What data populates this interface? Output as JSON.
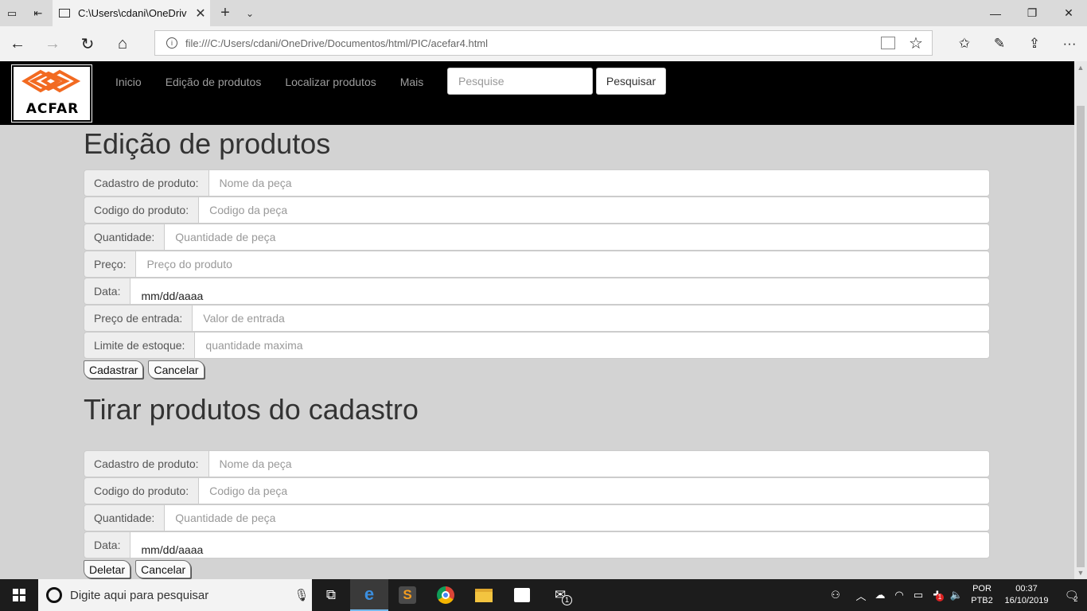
{
  "browser": {
    "tab_title": "C:\\Users\\cdani\\OneDriv",
    "url": "file:///C:/Users/cdani/OneDrive/Documentos/html/PIC/acefar4.html"
  },
  "site": {
    "logo_text": "ACFAR",
    "nav": [
      "Inicio",
      "Edição de produtos",
      "Localizar produtos",
      "Mais"
    ],
    "search_placeholder": "Pesquise",
    "search_button": "Pesquisar"
  },
  "edit_section": {
    "title": "Edição de produtos",
    "fields": [
      {
        "label": "Cadastro de produto:",
        "placeholder": "Nome da peça"
      },
      {
        "label": "Codigo do produto:",
        "placeholder": "Codigo da peça"
      },
      {
        "label": "Quantidade:",
        "placeholder": "Quantidade de peça"
      },
      {
        "label": "Preço:",
        "placeholder": "Preço do produto"
      },
      {
        "label": "Data:",
        "value": "mm/dd/aaaa"
      },
      {
        "label": "Preço de entrada:",
        "placeholder": "Valor de entrada"
      },
      {
        "label": "Limite de estoque:",
        "placeholder": "quantidade maxima"
      }
    ],
    "buttons": [
      "Cadastrar",
      "Cancelar"
    ]
  },
  "remove_section": {
    "title": "Tirar produtos do cadastro",
    "fields": [
      {
        "label": "Cadastro de produto:",
        "placeholder": "Nome da peça"
      },
      {
        "label": "Codigo do produto:",
        "placeholder": "Codigo da peça"
      },
      {
        "label": "Quantidade:",
        "placeholder": "Quantidade de peça"
      },
      {
        "label": "Data:",
        "value": "mm/dd/aaaa"
      }
    ],
    "buttons": [
      "Deletar",
      "Cancelar"
    ]
  },
  "taskbar": {
    "search_text": "Digite aqui para pesquisar",
    "lang_1": "POR",
    "lang_2": "PTB2",
    "time": "00:37",
    "date": "16/10/2019",
    "notifications": "2",
    "mail_badge": "1",
    "tray_badge": "1"
  }
}
